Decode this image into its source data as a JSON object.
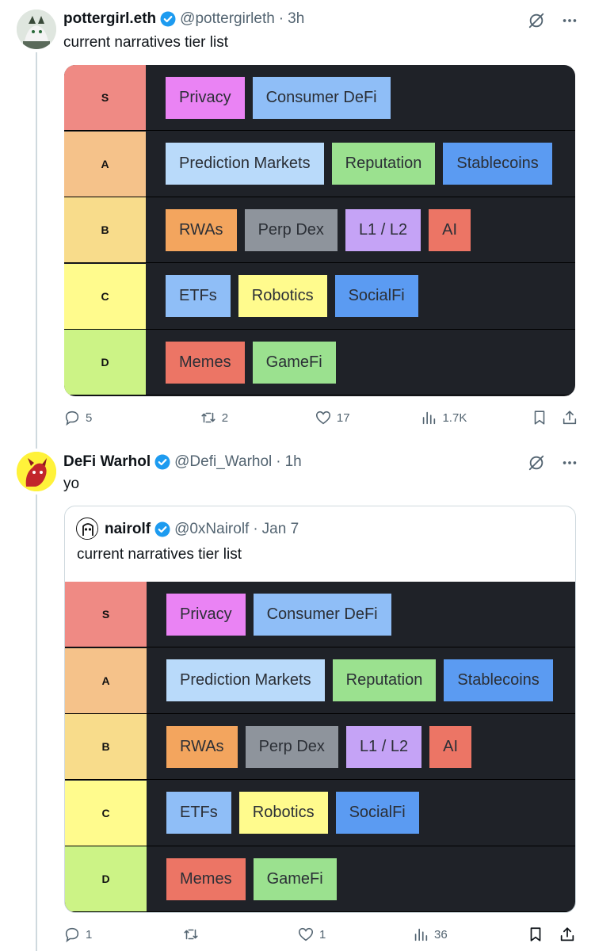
{
  "tweet1": {
    "name": "pottergirl.eth",
    "handle": "@pottergirleth",
    "dot": "·",
    "time": "3h",
    "text": "current narratives tier list",
    "actions": {
      "replies": "5",
      "reposts": "2",
      "likes": "17",
      "views": "1.7K"
    }
  },
  "tweet2": {
    "name": "DeFi Warhol",
    "handle": "@Defi_Warhol",
    "dot": "·",
    "time": "1h",
    "text": "yo",
    "actions": {
      "replies": "1",
      "reposts": "",
      "likes": "1",
      "views": "36"
    }
  },
  "quote": {
    "name": "nairolf",
    "handle": "@0xNairolf",
    "dot": "·",
    "time": "Jan 7",
    "text": "current narratives tier list"
  },
  "tiers": [
    {
      "label": "S",
      "color": "#ef8a84",
      "items": [
        {
          "label": "Privacy",
          "color": "#ea83f4"
        },
        {
          "label": "Consumer DeFi",
          "color": "#8fbef7"
        }
      ]
    },
    {
      "label": "A",
      "color": "#f5c28a",
      "items": [
        {
          "label": "Prediction Markets",
          "color": "#b9dafa"
        },
        {
          "label": "Reputation",
          "color": "#9be18f"
        },
        {
          "label": "Stablecoins",
          "color": "#5b9bf2"
        }
      ]
    },
    {
      "label": "B",
      "color": "#f8dc8b",
      "items": [
        {
          "label": "RWAs",
          "color": "#f3a55e"
        },
        {
          "label": "Perp Dex",
          "color": "#8e949c"
        },
        {
          "label": "L1 / L2",
          "color": "#c5a3f6"
        },
        {
          "label": "AI",
          "color": "#ec7565"
        }
      ]
    },
    {
      "label": "C",
      "color": "#fffb8d",
      "items": [
        {
          "label": "ETFs",
          "color": "#8fbef7"
        },
        {
          "label": "Robotics",
          "color": "#fffb8d"
        },
        {
          "label": "SocialFi",
          "color": "#5b9bf2"
        }
      ]
    },
    {
      "label": "D",
      "color": "#ccf386",
      "items": [
        {
          "label": "Memes",
          "color": "#ec7565"
        },
        {
          "label": "GameFi",
          "color": "#9be18f"
        }
      ]
    }
  ],
  "icons": {
    "verified": "verified-badge-icon",
    "grok": "grok-icon",
    "more": "more-icon",
    "reply": "reply-icon",
    "repost": "repost-icon",
    "like": "like-icon",
    "views": "views-icon",
    "bookmark": "bookmark-icon",
    "share": "share-icon"
  },
  "colors": {
    "verified": "#1d9bf0",
    "muted": "#536471",
    "tierBackground": "#1f2228"
  }
}
